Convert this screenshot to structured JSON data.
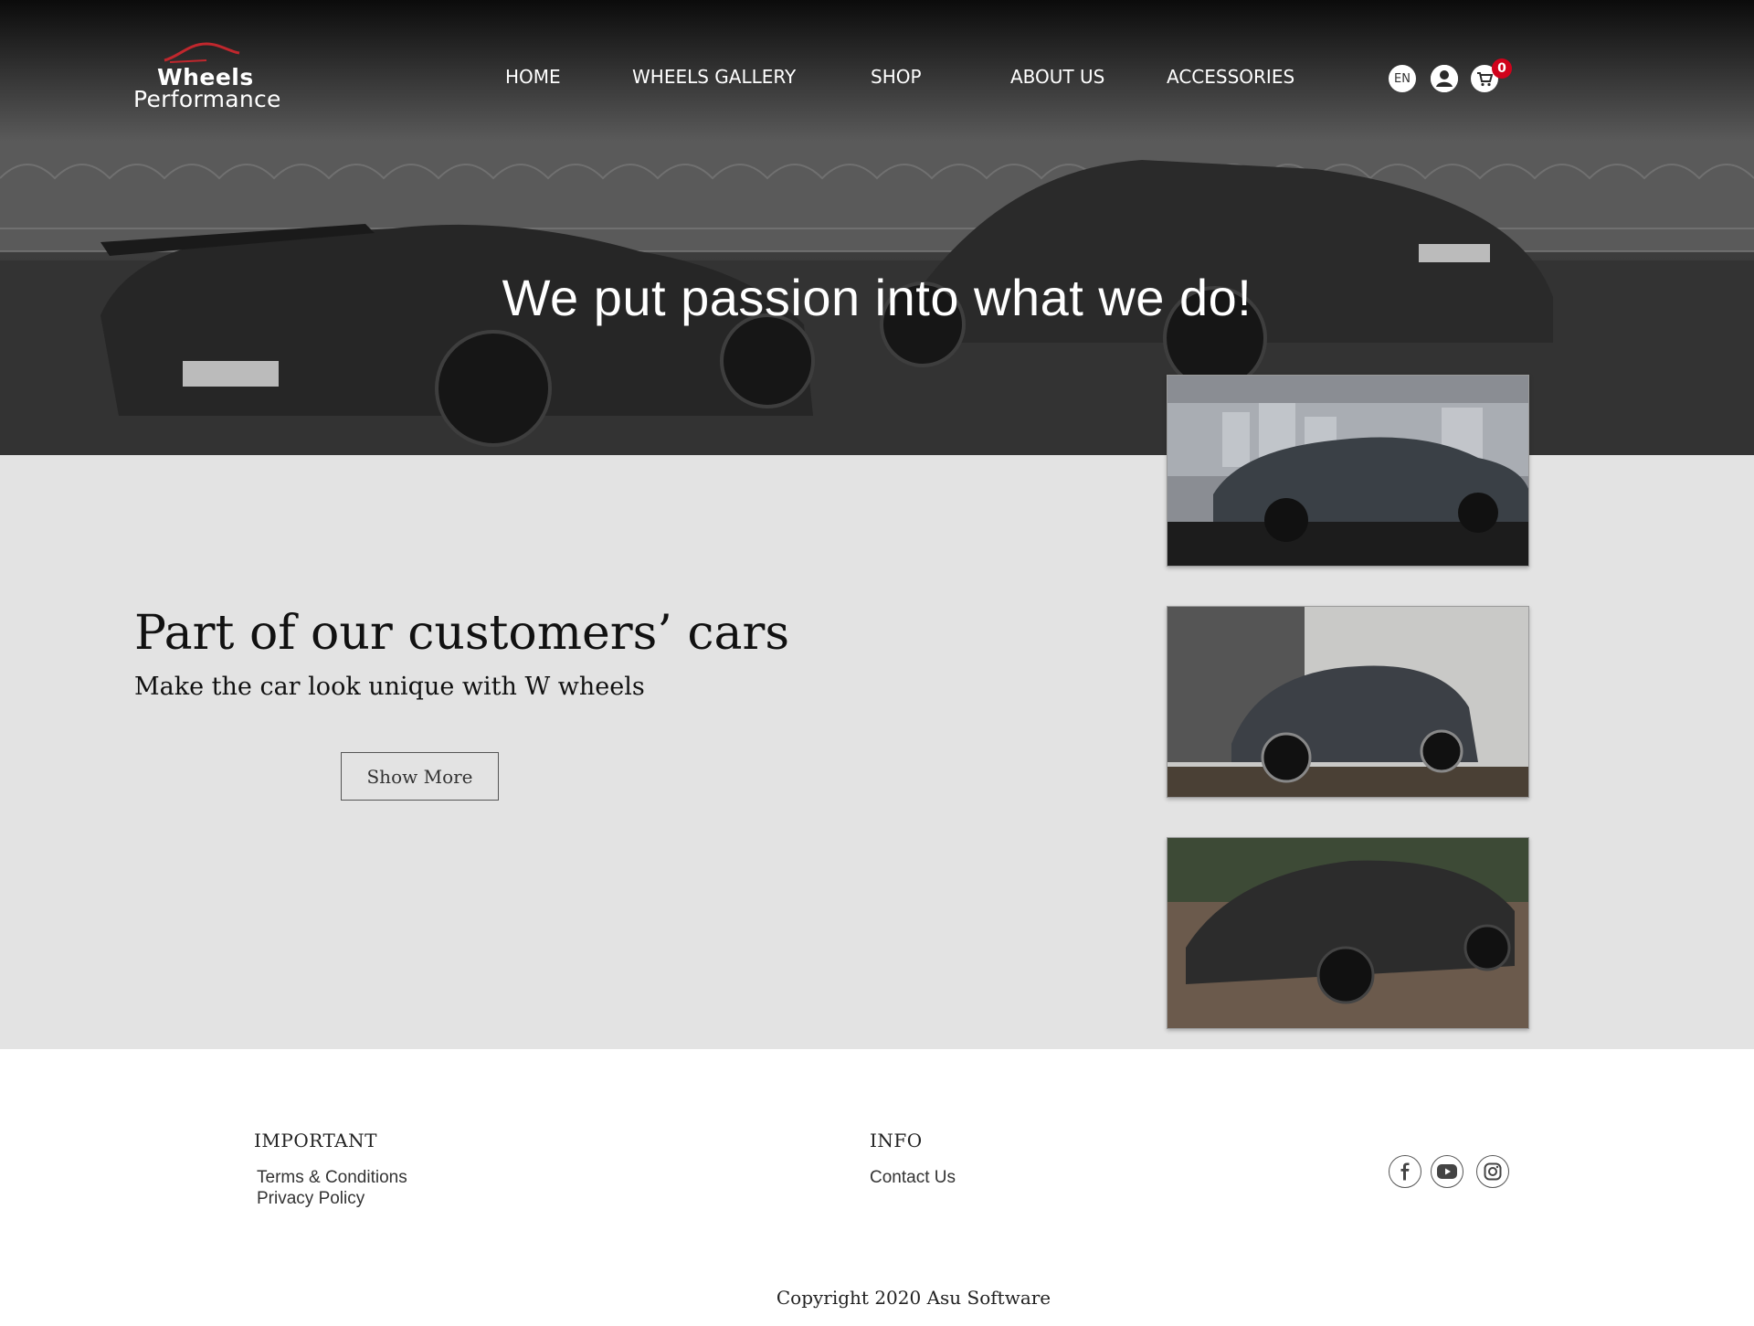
{
  "header": {
    "logo_line1": "Wheels",
    "logo_line2": "Performance",
    "nav": [
      {
        "label": "HOME"
      },
      {
        "label": "WHEELS GALLERY"
      },
      {
        "label": "SHOP"
      },
      {
        "label": "ABOUT US"
      },
      {
        "label": "ACCESSORIES"
      }
    ],
    "language": "EN",
    "cart_count": "0",
    "icons": [
      "language-icon",
      "user-icon",
      "cart-icon"
    ]
  },
  "hero": {
    "title": "We put passion into what we do!"
  },
  "gallery": {
    "heading": "Part of our customers’ cars",
    "subheading": "Make the car look unique with W wheels",
    "button_label": "Show More"
  },
  "footer": {
    "important_heading": "IMPORTANT",
    "important_links": [
      "Terms & Conditions",
      "Privacy Policy"
    ],
    "info_heading": "INFO",
    "info_links": [
      "Contact Us"
    ],
    "social": [
      "facebook-icon",
      "youtube-icon",
      "instagram-icon"
    ],
    "copyright": "Copyright 2020 Asu Software"
  },
  "colors": {
    "header_top": "#0b0b0b",
    "header_bottom": "#5a5a5a",
    "section_bg": "#e3e3e3",
    "badge": "#d0021b",
    "logo_accent": "#c0272d"
  }
}
